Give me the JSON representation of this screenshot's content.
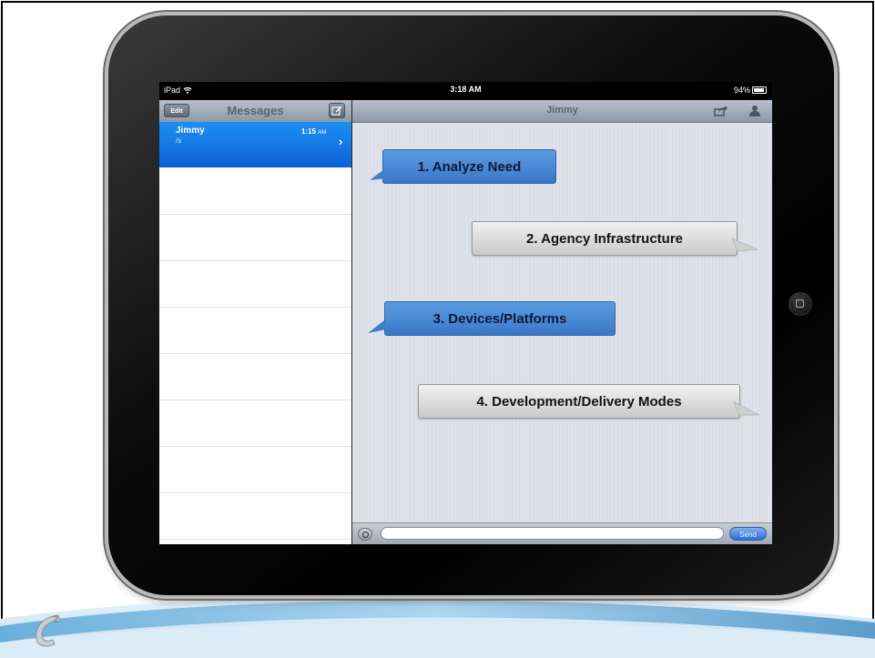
{
  "device": {
    "status_bar": {
      "carrier": "iPad",
      "time": "3:18 AM",
      "battery": "94%"
    }
  },
  "messages_list": {
    "edit_label": "Edit",
    "title": "Messages",
    "conversation": {
      "name": "Jimmy",
      "preview": "/s",
      "time": "1:15",
      "ampm": "AM"
    }
  },
  "conversation_view": {
    "title": "Jimmy",
    "send_label": "Send"
  },
  "callouts": [
    {
      "text": "1. Analyze Need",
      "style": "blue"
    },
    {
      "text": "2. Agency Infrastructure",
      "style": "gray"
    },
    {
      "text": "3. Devices/Platforms",
      "style": "blue"
    },
    {
      "text": "4. Development/Delivery Modes",
      "style": "gray"
    }
  ],
  "colors": {
    "blue_callout": "#4a88d6",
    "gray_callout": "#dcdcdc",
    "selection_blue": "#1577e6"
  },
  "icons": [
    "wifi-icon",
    "battery-icon",
    "compose-icon",
    "share-icon",
    "contact-icon",
    "camera-icon",
    "chevron-right-icon",
    "home-button-icon"
  ]
}
